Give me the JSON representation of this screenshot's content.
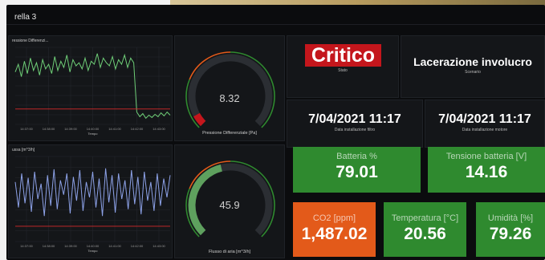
{
  "dashboard": {
    "title": "rella 3"
  },
  "colors": {
    "good": "#2f8a2f",
    "warn": "#e35a1a",
    "critical": "#c4161c",
    "series1": "#6fcf78",
    "series2": "#8da2e8",
    "threshold": "#d62a2a"
  },
  "charts": [
    {
      "title": "ressione Differenzi...",
      "xlabel": "Tempo",
      "ticks": [
        "14:37:00",
        "14:38:00",
        "14:39:00",
        "14:40:00",
        "14:41:00",
        "14:42:00",
        "14:43:00"
      ]
    },
    {
      "title": "ussa [m^3/h]",
      "xlabel": "Tempo",
      "ticks": [
        "14:37:00",
        "14:38:00",
        "14:39:00",
        "14:40:00",
        "14:41:00",
        "14:42:00",
        "14:43:00"
      ]
    }
  ],
  "chart_data": [
    {
      "type": "line",
      "title": "ressione Differenzi...",
      "xlabel": "Tempo",
      "x": [
        "14:37:00",
        "14:38:00",
        "14:39:00",
        "14:40:00",
        "14:41:00",
        "14:42:00",
        "14:43:00"
      ],
      "series": [
        {
          "values": [
            0.68,
            0.78,
            0.62,
            0.82,
            0.66,
            0.86,
            0.7,
            0.8,
            0.64,
            0.84,
            0.72,
            0.78,
            0.66,
            0.88,
            0.7,
            0.82,
            0.74,
            0.9,
            0.68,
            0.84,
            0.76,
            0.8,
            0.72,
            0.86,
            0.7,
            0.82,
            0.78,
            0.92,
            0.74,
            0.86,
            0.8,
            0.76,
            0.88,
            0.72,
            0.84,
            0.78,
            0.9,
            0.74,
            0.86,
            0.8,
            0.16,
            0.1,
            0.14,
            0.08,
            0.12,
            0.09,
            0.13,
            0.1,
            0.15,
            0.11,
            0.16,
            0.12
          ]
        }
      ],
      "threshold": 0.2,
      "ylim": [
        0,
        1
      ],
      "grid": true
    },
    {
      "type": "line",
      "title": "ussa [m^3/h]",
      "xlabel": "Tempo",
      "x": [
        "14:37:00",
        "14:38:00",
        "14:39:00",
        "14:40:00",
        "14:41:00",
        "14:42:00",
        "14:43:00"
      ],
      "series": [
        {
          "values": [
            0.7,
            0.4,
            0.8,
            0.45,
            0.75,
            0.35,
            0.82,
            0.5,
            0.68,
            0.3,
            0.78,
            0.42,
            0.85,
            0.38,
            0.72,
            0.55,
            0.8,
            0.33,
            0.76,
            0.48,
            0.84,
            0.36,
            0.7,
            0.52,
            0.82,
            0.4,
            0.74,
            0.3,
            0.86,
            0.46,
            0.78,
            0.34,
            0.8,
            0.5,
            0.72,
            0.38,
            0.84,
            0.44,
            0.76,
            0.32,
            0.82,
            0.48,
            0.7,
            0.36,
            0.8,
            0.42,
            0.74,
            0.52,
            0.78
          ]
        }
      ],
      "threshold": 0.18,
      "ylim": [
        0,
        1
      ],
      "grid": true
    }
  ],
  "gauges": [
    {
      "value": "8.32",
      "label": "Pressione Differenziale [Pa]",
      "fraction": 0.06,
      "bar_color": "#c4161c"
    },
    {
      "value": "45.9",
      "label": "Flusso di aria [m^3/h]",
      "fraction": 0.45,
      "bar_color": "#5ea05e"
    }
  ],
  "status": {
    "value": "Critico",
    "sub": "Stato"
  },
  "scenario": {
    "value": "Lacerazione involucro",
    "sub": "Scenario"
  },
  "install_filter": {
    "value": "7/04/2021 11:17",
    "sub": "Data installazione filtro"
  },
  "install_motor": {
    "value": "7/04/2021 11:17",
    "sub": "Data installazione motore"
  },
  "tiles": {
    "battery": {
      "label": "Batteria %",
      "value": "79.01",
      "color": "#2f8a2f"
    },
    "voltage": {
      "label": "Tensione batteria [V]",
      "value": "14.16",
      "color": "#2f8a2f"
    },
    "co2": {
      "label": "CO2 [ppm]",
      "value": "1,487.02",
      "color": "#e35a1a"
    },
    "temperature": {
      "label": "Temperatura [°C]",
      "value": "20.56",
      "color": "#2f8a2f"
    },
    "humidity": {
      "label": "Umidità [%]",
      "value": "79.26",
      "color": "#2f8a2f"
    }
  }
}
